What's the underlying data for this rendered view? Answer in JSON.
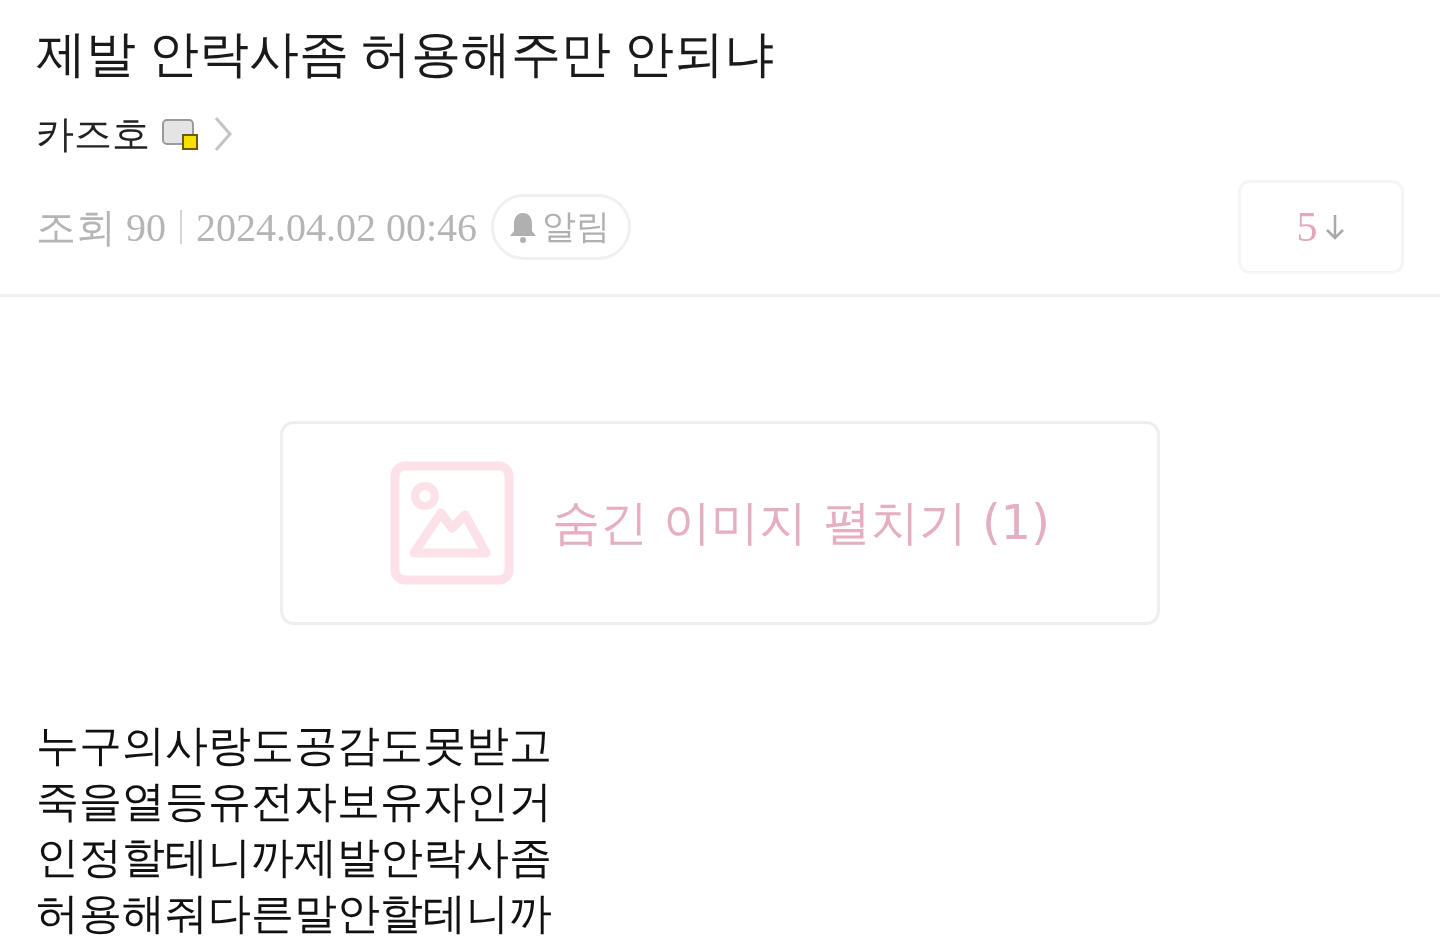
{
  "post": {
    "title": "제발 안락사좀 허용해주만 안되냐",
    "author": "카즈호",
    "views": "조회 90",
    "date": "2024.04.02 00:46",
    "alarm": "알림",
    "comments": "5"
  },
  "hidden_images": {
    "label": "숨긴 이미지 펼치기 (1)"
  },
  "body": [
    "누구의사랑도공감도못받고",
    "죽을열등유전자보유자인거",
    "인정할테니까제발안락사좀",
    "허용해줘다른말안할테니까"
  ]
}
